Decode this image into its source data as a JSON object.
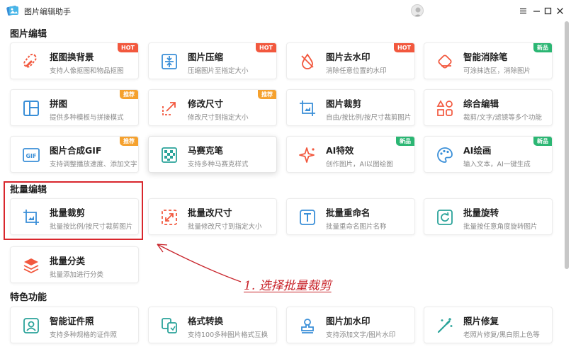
{
  "window": {
    "title": "图片编辑助手",
    "controls": [
      "settings-icon",
      "minimize-icon",
      "maximize-icon",
      "close-icon"
    ]
  },
  "sections": {
    "edit": "图片编辑",
    "batch": "批量编辑",
    "featured": "特色功能"
  },
  "cards": {
    "cutout": {
      "title": "抠图换背景",
      "subtitle": "支持人像抠图和物品抠图",
      "badge": "HOT",
      "icon": "cutout-icon"
    },
    "compress": {
      "title": "图片压缩",
      "subtitle": "压缩图片至指定大小",
      "badge": "HOT",
      "icon": "compress-icon"
    },
    "watermark_remove": {
      "title": "图片去水印",
      "subtitle": "消除任意位置的水印",
      "badge": "HOT",
      "icon": "watermark-remove-icon"
    },
    "smart_erase": {
      "title": "智能消除笔",
      "subtitle": "可涂抹选区，消除图片",
      "badge": "新品",
      "icon": "eraser-icon"
    },
    "puzzle": {
      "title": "拼图",
      "subtitle": "提供多种模板与拼接模式",
      "badge": "推荐",
      "icon": "collage-icon"
    },
    "resize": {
      "title": "修改尺寸",
      "subtitle": "修改尺寸到指定大小",
      "badge": "推荐",
      "icon": "resize-icon"
    },
    "crop": {
      "title": "图片裁剪",
      "subtitle": "自由/按比例/按尺寸裁剪图片",
      "icon": "crop-icon"
    },
    "composite": {
      "title": "综合编辑",
      "subtitle": "裁剪/文字/滤镜等多个功能",
      "icon": "shapes-icon"
    },
    "gif": {
      "title": "图片合成GIF",
      "subtitle": "支持调整播放速度、添加文字",
      "badge": "推荐",
      "icon": "gif-icon"
    },
    "mosaic": {
      "title": "马赛克笔",
      "subtitle": "支持多种马赛克样式",
      "icon": "mosaic-icon"
    },
    "ai_effect": {
      "title": "AI特效",
      "subtitle": "创作图片，AI以图绘图",
      "badge": "新品",
      "icon": "sparkle-icon"
    },
    "ai_paint": {
      "title": "AI绘画",
      "subtitle": "输入文本，AI一键生成",
      "badge": "新品",
      "icon": "palette-icon"
    },
    "batch_crop": {
      "title": "批量裁剪",
      "subtitle": "批量按比例/按尺寸裁剪图片",
      "icon": "crop-icon"
    },
    "batch_resize": {
      "title": "批量改尺寸",
      "subtitle": "批量修改尺寸到指定大小",
      "icon": "resize-icon"
    },
    "batch_rename": {
      "title": "批量重命名",
      "subtitle": "批量重命名图片名称",
      "icon": "text-icon"
    },
    "batch_rotate": {
      "title": "批量旋转",
      "subtitle": "批量按任意角度旋转图片",
      "icon": "rotate-icon"
    },
    "batch_classify": {
      "title": "批量分类",
      "subtitle": "批量添加进行分类",
      "icon": "layers-icon"
    },
    "id_photo": {
      "title": "智能证件照",
      "subtitle": "支持多种规格的证件照",
      "icon": "id-photo-icon"
    },
    "format": {
      "title": "格式转换",
      "subtitle": "支持100多种图片格式互换",
      "icon": "convert-icon"
    },
    "add_watermark": {
      "title": "图片加水印",
      "subtitle": "支持添加文字/图片水印",
      "icon": "stamp-icon"
    },
    "restore": {
      "title": "照片修复",
      "subtitle": "老照片修复/黑白照上色等",
      "icon": "magic-wand-icon"
    }
  },
  "annotation": "1. 选择批量裁剪",
  "colors": {
    "accent": "#2aa39a",
    "hot": "#f2583e",
    "recommend": "#f5a12e",
    "new": "#2bb673",
    "highlight": "#d9262c"
  }
}
